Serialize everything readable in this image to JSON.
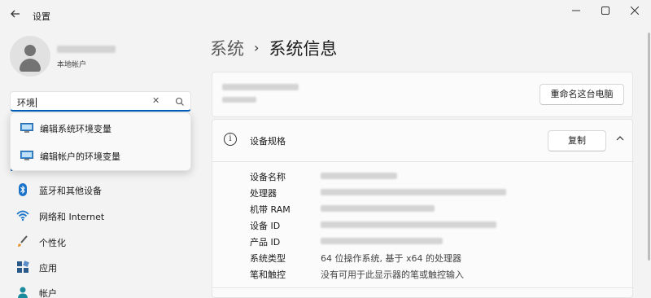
{
  "window": {
    "title": "设置",
    "minimize": "—",
    "maximize": "☐",
    "close": "✕"
  },
  "profile": {
    "account_type": "本地帐户"
  },
  "search": {
    "value": "环境",
    "suggestions": [
      {
        "label": "编辑系统环境变量",
        "icon": "system-properties-icon"
      },
      {
        "label": "编辑帐户的环境变量",
        "icon": "system-properties-icon"
      }
    ]
  },
  "nav": {
    "items": [
      {
        "label": "蓝牙和其他设备",
        "icon": "bluetooth-icon"
      },
      {
        "label": "网络和 Internet",
        "icon": "wifi-icon"
      },
      {
        "label": "个性化",
        "icon": "brush-icon"
      },
      {
        "label": "应用",
        "icon": "apps-icon"
      },
      {
        "label": "帐户",
        "icon": "person-icon"
      }
    ]
  },
  "breadcrumb": {
    "parent": "系统",
    "separator": "›",
    "current": "系统信息"
  },
  "device_card": {
    "rename_button": "重命名这台电脑"
  },
  "specs": {
    "title": "设备规格",
    "copy_button": "复制",
    "rows": [
      {
        "key": "设备名称",
        "value": ""
      },
      {
        "key": "处理器",
        "value": ""
      },
      {
        "key": "机带 RAM",
        "value": ""
      },
      {
        "key": "设备 ID",
        "value": ""
      },
      {
        "key": "产品 ID",
        "value": ""
      },
      {
        "key": "系统类型",
        "value": "64 位操作系统, 基于 x64 的处理器"
      },
      {
        "key": "笔和触控",
        "value": "没有可用于此显示器的笔或触控输入"
      }
    ]
  },
  "colors": {
    "accent": "#005fb8",
    "background": "#f3f3f3",
    "card": "#fbfbfb"
  }
}
